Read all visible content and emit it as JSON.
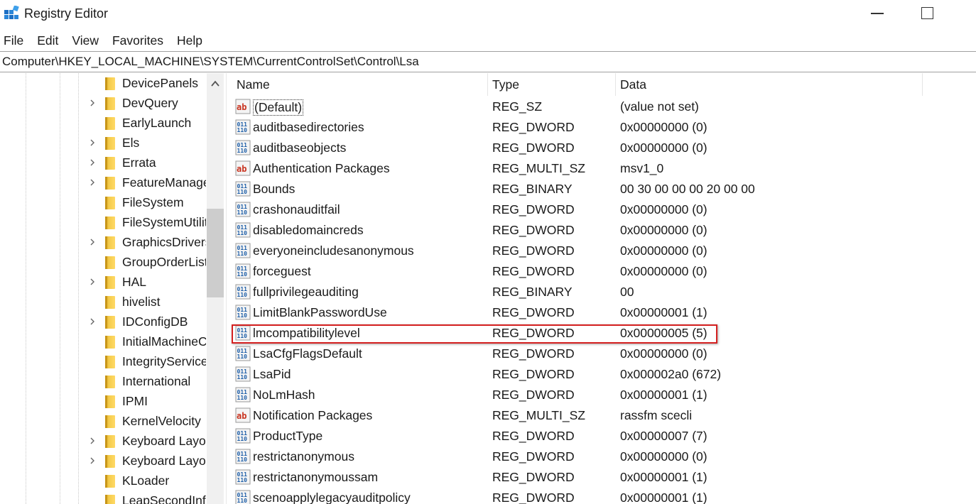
{
  "window": {
    "title": "Registry Editor",
    "app_icon": "registry-editor-icon",
    "controls": [
      "minimize-icon",
      "maximize-icon"
    ]
  },
  "menu": [
    "File",
    "Edit",
    "View",
    "Favorites",
    "Help"
  ],
  "address": "Computer\\HKEY_LOCAL_MACHINE\\SYSTEM\\CurrentControlSet\\Control\\Lsa",
  "tree": {
    "items": [
      {
        "label": "DevicePanels",
        "expandable": false
      },
      {
        "label": "DevQuery",
        "expandable": true
      },
      {
        "label": "EarlyLaunch",
        "expandable": false
      },
      {
        "label": "Els",
        "expandable": true
      },
      {
        "label": "Errata",
        "expandable": true
      },
      {
        "label": "FeatureManage",
        "expandable": true
      },
      {
        "label": "FileSystem",
        "expandable": false
      },
      {
        "label": "FileSystemUtilit",
        "expandable": false
      },
      {
        "label": "GraphicsDrivers",
        "expandable": true
      },
      {
        "label": "GroupOrderList",
        "expandable": false
      },
      {
        "label": "HAL",
        "expandable": true
      },
      {
        "label": "hivelist",
        "expandable": false
      },
      {
        "label": "IDConfigDB",
        "expandable": true
      },
      {
        "label": "InitialMachineC",
        "expandable": false
      },
      {
        "label": "IntegrityService",
        "expandable": false
      },
      {
        "label": "International",
        "expandable": false
      },
      {
        "label": "IPMI",
        "expandable": false
      },
      {
        "label": "KernelVelocity",
        "expandable": false
      },
      {
        "label": "Keyboard Layo",
        "expandable": true
      },
      {
        "label": "Keyboard Layo",
        "expandable": true
      },
      {
        "label": "KLoader",
        "expandable": false
      },
      {
        "label": "LeapSecondInf",
        "expandable": false
      }
    ]
  },
  "list": {
    "columns": [
      "Name",
      "Type",
      "Data"
    ],
    "highlighted_row": 11,
    "rows": [
      {
        "icon": "string-value-icon",
        "name": "(Default)",
        "type": "REG_SZ",
        "data": "(value not set)"
      },
      {
        "icon": "binary-value-icon",
        "name": "auditbasedirectories",
        "type": "REG_DWORD",
        "data": "0x00000000 (0)"
      },
      {
        "icon": "binary-value-icon",
        "name": "auditbaseobjects",
        "type": "REG_DWORD",
        "data": "0x00000000 (0)"
      },
      {
        "icon": "string-value-icon",
        "name": "Authentication Packages",
        "type": "REG_MULTI_SZ",
        "data": "msv1_0"
      },
      {
        "icon": "binary-value-icon",
        "name": "Bounds",
        "type": "REG_BINARY",
        "data": "00 30 00 00 00 20 00 00"
      },
      {
        "icon": "binary-value-icon",
        "name": "crashonauditfail",
        "type": "REG_DWORD",
        "data": "0x00000000 (0)"
      },
      {
        "icon": "binary-value-icon",
        "name": "disabledomaincreds",
        "type": "REG_DWORD",
        "data": "0x00000000 (0)"
      },
      {
        "icon": "binary-value-icon",
        "name": "everyoneincludesanonymous",
        "type": "REG_DWORD",
        "data": "0x00000000 (0)"
      },
      {
        "icon": "binary-value-icon",
        "name": "forceguest",
        "type": "REG_DWORD",
        "data": "0x00000000 (0)"
      },
      {
        "icon": "binary-value-icon",
        "name": "fullprivilegeauditing",
        "type": "REG_BINARY",
        "data": "00"
      },
      {
        "icon": "binary-value-icon",
        "name": "LimitBlankPasswordUse",
        "type": "REG_DWORD",
        "data": "0x00000001 (1)"
      },
      {
        "icon": "binary-value-icon",
        "name": "lmcompatibilitylevel",
        "type": "REG_DWORD",
        "data": "0x00000005 (5)"
      },
      {
        "icon": "binary-value-icon",
        "name": "LsaCfgFlagsDefault",
        "type": "REG_DWORD",
        "data": "0x00000000 (0)"
      },
      {
        "icon": "binary-value-icon",
        "name": "LsaPid",
        "type": "REG_DWORD",
        "data": "0x000002a0 (672)"
      },
      {
        "icon": "binary-value-icon",
        "name": "NoLmHash",
        "type": "REG_DWORD",
        "data": "0x00000001 (1)"
      },
      {
        "icon": "string-value-icon",
        "name": "Notification Packages",
        "type": "REG_MULTI_SZ",
        "data": "rassfm scecli"
      },
      {
        "icon": "binary-value-icon",
        "name": "ProductType",
        "type": "REG_DWORD",
        "data": "0x00000007 (7)"
      },
      {
        "icon": "binary-value-icon",
        "name": "restrictanonymous",
        "type": "REG_DWORD",
        "data": "0x00000000 (0)"
      },
      {
        "icon": "binary-value-icon",
        "name": "restrictanonymoussam",
        "type": "REG_DWORD",
        "data": "0x00000001 (1)"
      },
      {
        "icon": "binary-value-icon",
        "name": "scenoapplylegacyauditpolicy",
        "type": "REG_DWORD",
        "data": "0x00000001 (1)"
      }
    ]
  },
  "colors": {
    "highlight_border": "#d42020",
    "folder": "#f5cc4c",
    "string_icon": "#c8321e",
    "binary_icon": "#1f5fa8"
  }
}
